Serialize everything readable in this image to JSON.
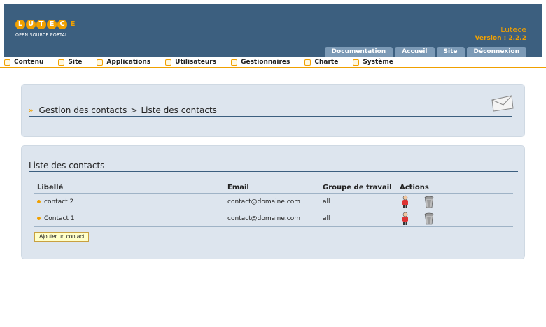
{
  "header": {
    "logo_letters": [
      "L",
      "U",
      "T",
      "E",
      "C",
      "E"
    ],
    "logo_subtitle": "OPEN SOURCE PORTAL",
    "brand_name": "Lutece",
    "brand_version": "Version : 2.2.2",
    "tabs": [
      "Documentation",
      "Accueil",
      "Site",
      "Déconnexion"
    ]
  },
  "menu": {
    "items": [
      "Contenu",
      "Site",
      "Applications",
      "Utilisateurs",
      "Gestionnaires",
      "Charte",
      "Système"
    ]
  },
  "breadcrumb": {
    "text": "Gestion des contacts",
    "separator": ">",
    "current": "Liste des contacts"
  },
  "section": {
    "title": "Liste des contacts"
  },
  "table": {
    "headers": [
      "Libellé",
      "Email",
      "Groupe de travail",
      "Actions"
    ],
    "rows": [
      {
        "label": "contact 2",
        "email": "contact@domaine.com",
        "group": "all"
      },
      {
        "label": "Contact 1",
        "email": "contact@domaine.com",
        "group": "all"
      }
    ]
  },
  "add_button": "Ajouter un contact",
  "icons": {
    "mail": "mail-icon",
    "edit": "user-edit-icon",
    "delete": "trash-icon"
  },
  "colors": {
    "header_bg": "#3c5f7f",
    "accent": "#f0a000",
    "panel_bg": "#dde5ee",
    "tab_bg": "#7c9ab6"
  }
}
